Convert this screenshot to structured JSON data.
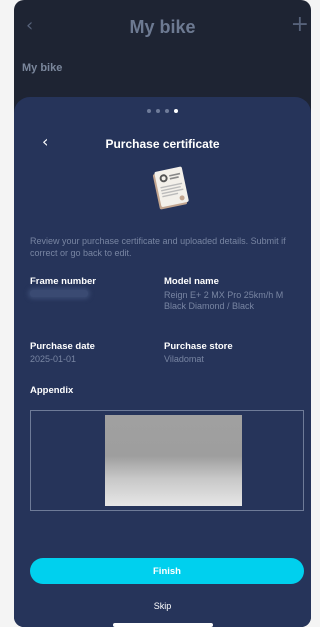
{
  "app_header": {
    "back_icon": "chevron-left-icon",
    "title": "My bike",
    "add_icon": "plus-icon",
    "subtitle": "My bike"
  },
  "sheet": {
    "pagination": {
      "total": 4,
      "active_index": 3
    },
    "back_icon": "chevron-left-icon",
    "title": "Purchase certificate",
    "certificate_icon": "certificate-document-icon",
    "description": "Review your purchase certificate and uploaded details. Submit if correct or go back to edit.",
    "frame_number": {
      "label": "Frame number",
      "value_blurred": true
    },
    "model_name": {
      "label": "Model name",
      "value": "Reign E+ 2 MX Pro 25km/h M Black Diamond / Black"
    },
    "purchase_date": {
      "label": "Purchase date",
      "value": "2025-01-01"
    },
    "purchase_store": {
      "label": "Purchase store",
      "value": "Viladomat"
    },
    "appendix": {
      "label": "Appendix",
      "image_blurred": true
    },
    "finish_label": "Finish",
    "skip_label": "Skip"
  },
  "colors": {
    "background": "#1e2433",
    "sheet": "#26345a",
    "accent": "#00d0ee",
    "muted_text": "#7885a2"
  }
}
